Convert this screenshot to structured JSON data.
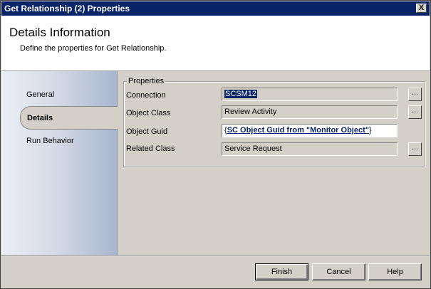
{
  "window": {
    "title": "Get Relationship (2) Properties",
    "close_label": "X"
  },
  "header": {
    "title": "Details Information",
    "subtitle": "Define the properties for Get Relationship."
  },
  "sidebar": {
    "items": [
      {
        "label": "General"
      },
      {
        "label": "Details"
      },
      {
        "label": "Run Behavior"
      }
    ]
  },
  "properties": {
    "legend": "Properties",
    "connection": {
      "label": "Connection",
      "value": "SCSM12"
    },
    "object_class": {
      "label": "Object Class",
      "value": "Review Activity"
    },
    "object_guid": {
      "label": "Object Guid",
      "brace_open": "{",
      "value": "SC Object Guid from \"Monitor Object\"",
      "brace_close": "}"
    },
    "related_class": {
      "label": "Related Class",
      "value": "Service Request"
    },
    "ellipsis": "..."
  },
  "buttons": {
    "finish": "Finish",
    "cancel": "Cancel",
    "help": "Help"
  }
}
